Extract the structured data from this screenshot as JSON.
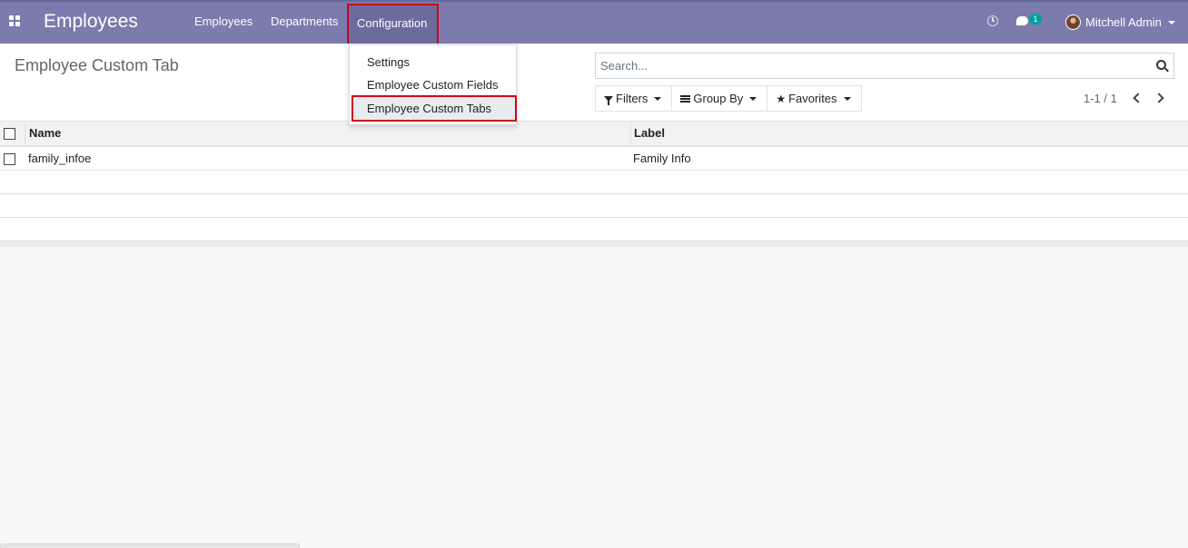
{
  "app": {
    "title": "Employees",
    "menu": [
      {
        "label": "Employees"
      },
      {
        "label": "Departments"
      },
      {
        "label": "Configuration"
      }
    ]
  },
  "systray": {
    "chat_badge_count": "1",
    "user_name": "Mitchell Admin"
  },
  "config_dropdown": {
    "items": [
      {
        "label": "Settings"
      },
      {
        "label": "Employee Custom Fields"
      },
      {
        "label": "Employee Custom Tabs",
        "active": true
      }
    ]
  },
  "control_panel": {
    "title": "Employee Custom Tab",
    "search_placeholder": "Search...",
    "filters_label": "Filters",
    "group_by_label": "Group By",
    "favorites_label": "Favorites",
    "pager": "1-1 / 1"
  },
  "list": {
    "columns": [
      {
        "label": "Name"
      },
      {
        "label": "Label"
      }
    ],
    "rows": [
      {
        "name": "family_infoe",
        "label": "Family Info"
      }
    ]
  },
  "colors": {
    "navbar": "#7c7bad",
    "highlight_border": "#d0021b",
    "badge": "#00a09d"
  }
}
